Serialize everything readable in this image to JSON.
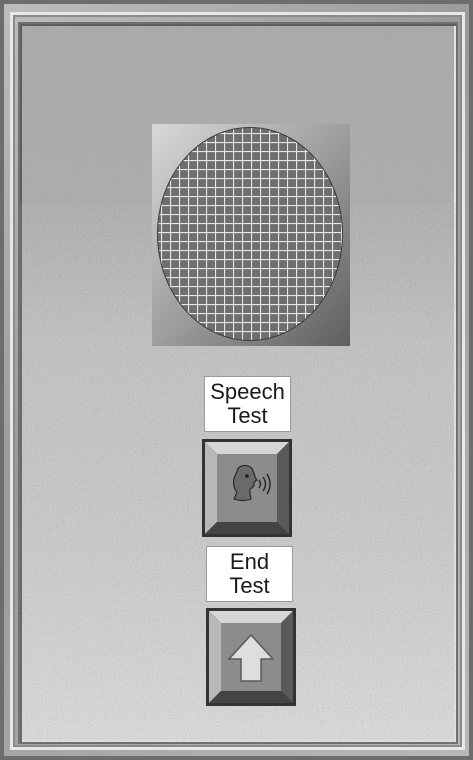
{
  "window": {
    "frame_color": "#6d6d6d",
    "panel_color": "#b5b5b5"
  },
  "speaker": {
    "icon": "speaker-grille-icon"
  },
  "speech_test": {
    "label_line1": "Speech",
    "label_line2": "Test",
    "icon": "speaking-head-icon"
  },
  "end_test": {
    "label_line1": "End",
    "label_line2": "Test",
    "icon": "up-arrow-icon"
  }
}
